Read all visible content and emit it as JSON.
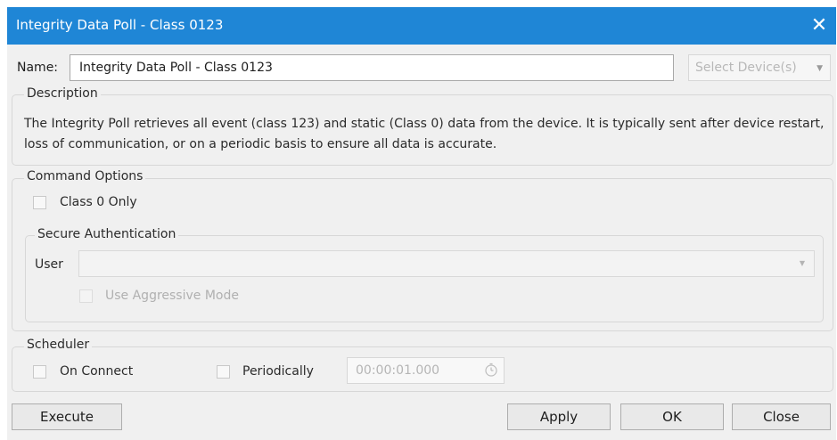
{
  "window": {
    "title": "Integrity Data Poll - Class 0123",
    "close_icon": "close-icon"
  },
  "name": {
    "label": "Name:",
    "value": "Integrity Data Poll - Class 0123"
  },
  "device_select": {
    "placeholder": "Select Device(s)",
    "arrow_icon": "dropdown-arrow-icon"
  },
  "description": {
    "title": "Description",
    "text": "The Integrity Poll retrieves all event (class 123) and static (Class 0) data from the device. It is typically sent after device restart, loss of communication, or on a periodic basis to ensure all data is accurate."
  },
  "command_options": {
    "title": "Command Options",
    "class0_only": {
      "label": "Class 0 Only",
      "checked": false
    },
    "secure_auth": {
      "title": "Secure Authentication",
      "user_label": "User",
      "user_value": "",
      "aggressive_mode": {
        "label": "Use Aggressive Mode",
        "checked": false,
        "enabled": false
      }
    }
  },
  "scheduler": {
    "title": "Scheduler",
    "on_connect": {
      "label": "On Connect",
      "checked": false
    },
    "periodically": {
      "label": "Periodically",
      "checked": false
    },
    "interval": {
      "value": "00:00:01.000",
      "icon": "clock-icon"
    }
  },
  "buttons": {
    "execute": "Execute",
    "apply": "Apply",
    "ok": "OK",
    "close": "Close"
  },
  "colors": {
    "titlebar": "#1f86d6",
    "dialog_bg": "#f0f0f0",
    "disabled_text": "#b0b0b0"
  }
}
